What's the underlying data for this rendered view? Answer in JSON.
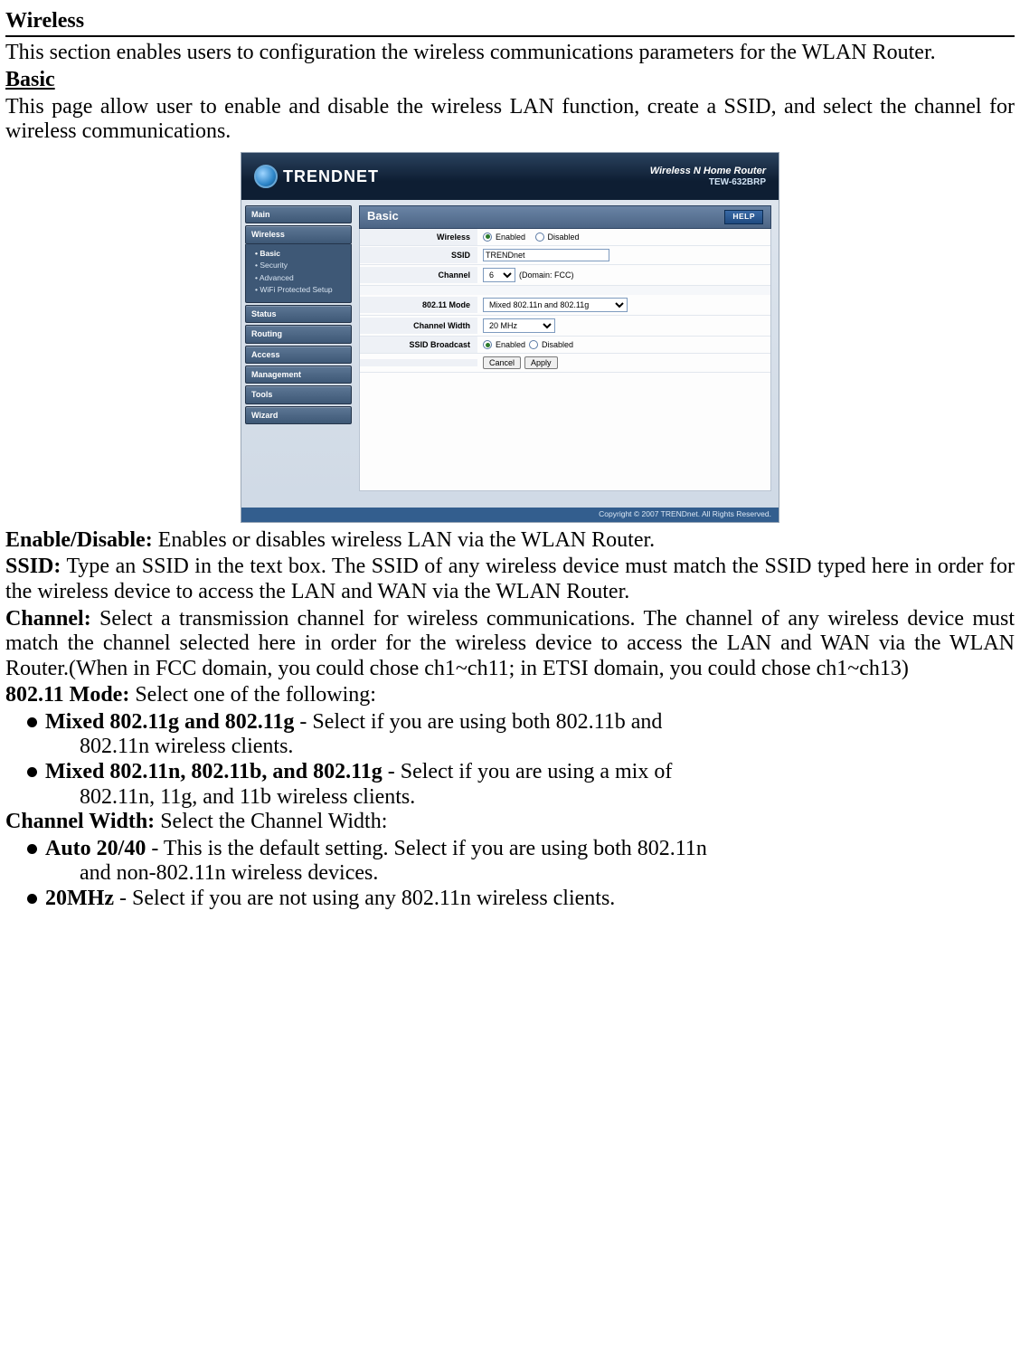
{
  "page": {
    "section_title": "Wireless",
    "section_intro": "This section enables users to configuration the wireless communications parameters for the WLAN Router.",
    "basic_heading": "Basic",
    "basic_intro": "This page allow user to enable and disable the wireless LAN function, create a SSID, and select the channel for wireless communications."
  },
  "router": {
    "brand": "TRENDNET",
    "product_line1": "Wireless N Home Router",
    "product_line2": "TEW-632BRP",
    "panel_title": "Basic",
    "help_label": "HELP",
    "footer": "Copyright © 2007 TRENDnet. All Rights Reserved.",
    "nav": {
      "main": "Main",
      "wireless": "Wireless",
      "status": "Status",
      "routing": "Routing",
      "access": "Access",
      "management": "Management",
      "tools": "Tools",
      "wizard": "Wizard"
    },
    "subnav": {
      "basic": "Basic",
      "security": "Security",
      "advanced": "Advanced",
      "wps": "WiFi Protected Setup"
    },
    "form": {
      "wireless_label": "Wireless",
      "enabled_label": "Enabled",
      "disabled_label": "Disabled",
      "ssid_label": "SSID",
      "ssid_value": "TRENDnet",
      "channel_label": "Channel",
      "channel_value": "6",
      "channel_domain": "(Domain: FCC)",
      "mode_label": "802.11 Mode",
      "mode_value": "Mixed 802.11n and 802.11g",
      "width_label": "Channel Width",
      "width_value": "20 MHz",
      "broadcast_label": "SSID Broadcast",
      "cancel": "Cancel",
      "apply": "Apply"
    }
  },
  "defs": {
    "enable_label": "Enable/Disable:",
    "enable_text": " Enables or disables wireless LAN via the WLAN Router.",
    "ssid_label": "SSID:",
    "ssid_text": " Type an SSID in the text box. The SSID of any wireless device must match the SSID typed here in order for the wireless device to access the LAN and WAN via the WLAN Router.",
    "channel_label": "Channel:",
    "channel_text": " Select a transmission channel for wireless communications. The channel of any wireless device must match the channel selected here in order for the wireless device to access the LAN and WAN via the WLAN Router.(When in FCC domain, you could chose ch1~ch11; in ETSI domain, you could chose ch1~ch13)",
    "mode_label": "802.11 Mode:",
    "mode_text": " Select one of the following:",
    "mode_b1_bold": "Mixed 802.11g and 802.11g",
    "mode_b1_rest": " - Select if you are using both 802.11b and",
    "mode_b1_cont": "802.11n wireless clients.",
    "mode_b2_bold": "Mixed 802.11n, 802.11b, and 802.11g",
    "mode_b2_rest": " - Select if you are using a mix of",
    "mode_b2_cont": "802.11n, 11g, and 11b wireless clients.",
    "cw_label": "Channel Width:",
    "cw_text": " Select the Channel Width:",
    "cw_b1_bold": "Auto 20/40",
    "cw_b1_rest": " - This is the default setting. Select if you are using both 802.11n",
    "cw_b1_cont": "and non-802.11n wireless devices.",
    "cw_b2_bold": "20MHz",
    "cw_b2_rest": " - Select if you are not using any 802.11n wireless clients."
  }
}
